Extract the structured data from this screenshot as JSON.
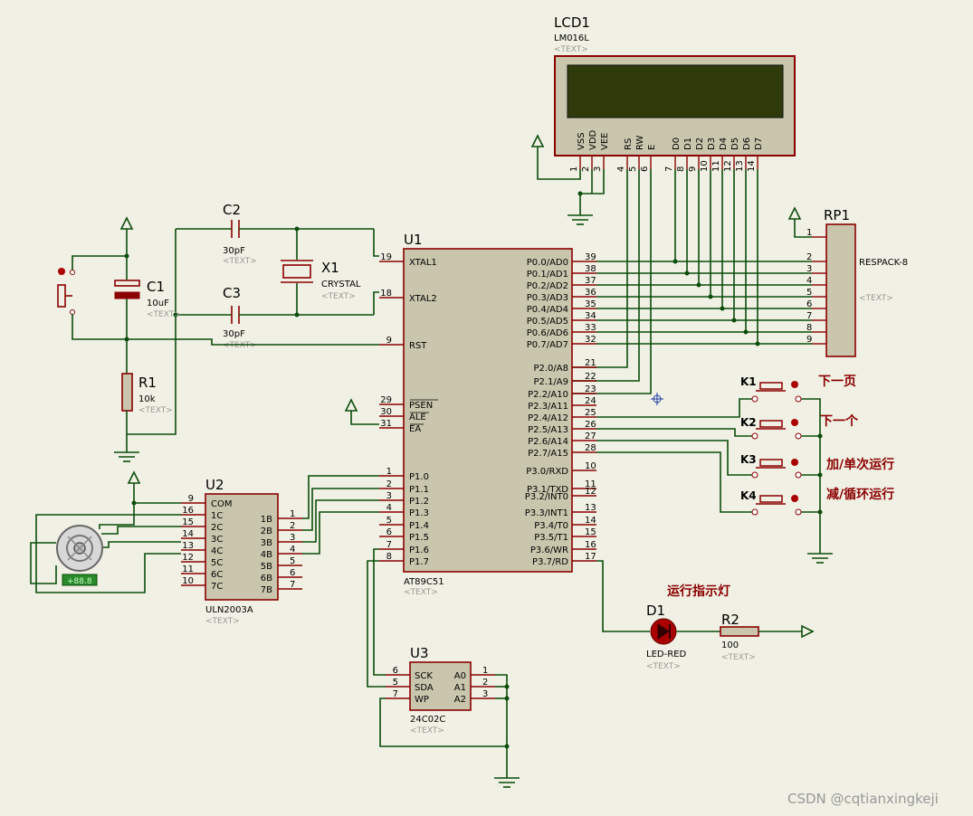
{
  "lcd": {
    "ref": "LCD1",
    "value": "LM016L",
    "text": "<TEXT>",
    "pins": [
      {
        "label": "VSS",
        "num": "1"
      },
      {
        "label": "VDD",
        "num": "2"
      },
      {
        "label": "VEE",
        "num": "3"
      },
      {
        "label": "RS",
        "num": "4"
      },
      {
        "label": "RW",
        "num": "5"
      },
      {
        "label": "E",
        "num": "6"
      },
      {
        "label": "D0",
        "num": "7"
      },
      {
        "label": "D1",
        "num": "8"
      },
      {
        "label": "D2",
        "num": "9"
      },
      {
        "label": "D3",
        "num": "10"
      },
      {
        "label": "D4",
        "num": "11"
      },
      {
        "label": "D5",
        "num": "12"
      },
      {
        "label": "D6",
        "num": "13"
      },
      {
        "label": "D7",
        "num": "14"
      }
    ]
  },
  "rp1": {
    "ref": "RP1",
    "value": "RESPACK-8",
    "text": "<TEXT>",
    "pins": [
      "1",
      "2",
      "3",
      "4",
      "5",
      "6",
      "7",
      "8",
      "9"
    ]
  },
  "u1": {
    "ref": "U1",
    "value": "AT89C51",
    "text": "<TEXT>",
    "left": [
      {
        "label": "XTAL1",
        "num": "19"
      },
      {
        "label": "XTAL2",
        "num": "18"
      },
      {
        "label": "RST",
        "num": "9"
      },
      {
        "label": "PSEN",
        "num": "29"
      },
      {
        "label": "ALE",
        "num": "30"
      },
      {
        "label": "EA",
        "num": "31"
      },
      {
        "label": "P1.0",
        "num": "1"
      },
      {
        "label": "P1.1",
        "num": "2"
      },
      {
        "label": "P1.2",
        "num": "3"
      },
      {
        "label": "P1.3",
        "num": "4"
      },
      {
        "label": "P1.4",
        "num": "5"
      },
      {
        "label": "P1.5",
        "num": "6"
      },
      {
        "label": "P1.6",
        "num": "7"
      },
      {
        "label": "P1.7",
        "num": "8"
      }
    ],
    "right": [
      {
        "label": "P0.0/AD0",
        "num": "39"
      },
      {
        "label": "P0.1/AD1",
        "num": "38"
      },
      {
        "label": "P0.2/AD2",
        "num": "37"
      },
      {
        "label": "P0.3/AD3",
        "num": "36"
      },
      {
        "label": "P0.4/AD4",
        "num": "35"
      },
      {
        "label": "P0.5/AD5",
        "num": "34"
      },
      {
        "label": "P0.6/AD6",
        "num": "33"
      },
      {
        "label": "P0.7/AD7",
        "num": "32"
      },
      {
        "label": "P2.0/A8",
        "num": "21"
      },
      {
        "label": "P2.1/A9",
        "num": "22"
      },
      {
        "label": "P2.2/A10",
        "num": "23"
      },
      {
        "label": "P2.3/A11",
        "num": "24"
      },
      {
        "label": "P2.4/A12",
        "num": "25"
      },
      {
        "label": "P2.5/A13",
        "num": "26"
      },
      {
        "label": "P2.6/A14",
        "num": "27"
      },
      {
        "label": "P2.7/A15",
        "num": "28"
      },
      {
        "label": "P3.0/RXD",
        "num": "10"
      },
      {
        "label": "P3.1/TXD",
        "num": "11"
      },
      {
        "label": "P3.2/INT0",
        "num": "12"
      },
      {
        "label": "P3.3/INT1",
        "num": "13"
      },
      {
        "label": "P3.4/T0",
        "num": "14"
      },
      {
        "label": "P3.5/T1",
        "num": "15"
      },
      {
        "label": "P3.6/WR",
        "num": "16"
      },
      {
        "label": "P3.7/RD",
        "num": "17"
      }
    ]
  },
  "u2": {
    "ref": "U2",
    "value": "ULN2003A",
    "text": "<TEXT>",
    "left": [
      {
        "label": "COM",
        "num": "9"
      },
      {
        "label": "1C",
        "num": "16"
      },
      {
        "label": "2C",
        "num": "15"
      },
      {
        "label": "3C",
        "num": "14"
      },
      {
        "label": "4C",
        "num": "13"
      },
      {
        "label": "5C",
        "num": "12"
      },
      {
        "label": "6C",
        "num": "11"
      },
      {
        "label": "7C",
        "num": "10"
      }
    ],
    "right": [
      {
        "label": "1B",
        "num": "1"
      },
      {
        "label": "2B",
        "num": "2"
      },
      {
        "label": "3B",
        "num": "3"
      },
      {
        "label": "4B",
        "num": "4"
      },
      {
        "label": "5B",
        "num": "5"
      },
      {
        "label": "6B",
        "num": "6"
      },
      {
        "label": "7B",
        "num": "7"
      }
    ]
  },
  "u3": {
    "ref": "U3",
    "value": "24C02C",
    "text": "<TEXT>",
    "left": [
      {
        "label": "SCK",
        "num": "6"
      },
      {
        "label": "SDA",
        "num": "5"
      },
      {
        "label": "WP",
        "num": "7"
      }
    ],
    "right": [
      {
        "label": "A0",
        "num": "1"
      },
      {
        "label": "A1",
        "num": "2"
      },
      {
        "label": "A2",
        "num": "3"
      }
    ]
  },
  "c1": {
    "ref": "C1",
    "value": "10uF",
    "text": "<TEXT>"
  },
  "c2": {
    "ref": "C2",
    "value": "30pF",
    "text": "<TEXT>"
  },
  "c3": {
    "ref": "C3",
    "value": "30pF",
    "text": "<TEXT>"
  },
  "x1": {
    "ref": "X1",
    "value": "CRYSTAL",
    "text": "<TEXT>"
  },
  "r1": {
    "ref": "R1",
    "value": "10k",
    "text": "<TEXT>"
  },
  "r2": {
    "ref": "R2",
    "value": "100",
    "text": "<TEXT>"
  },
  "d1": {
    "ref": "D1",
    "value": "LED-RED",
    "text": "<TEXT>"
  },
  "motor": {
    "readout": "+88.8"
  },
  "keys": [
    {
      "ref": "K1",
      "label": "下一页"
    },
    {
      "ref": "K2",
      "label": "下一个"
    },
    {
      "ref": "K3",
      "label": "加/单次运行"
    },
    {
      "ref": "K4",
      "label": "减/循环运行"
    }
  ],
  "annotations": {
    "run_indicator": "运行指示灯"
  },
  "watermark": "CSDN @cqtianxingkeji"
}
